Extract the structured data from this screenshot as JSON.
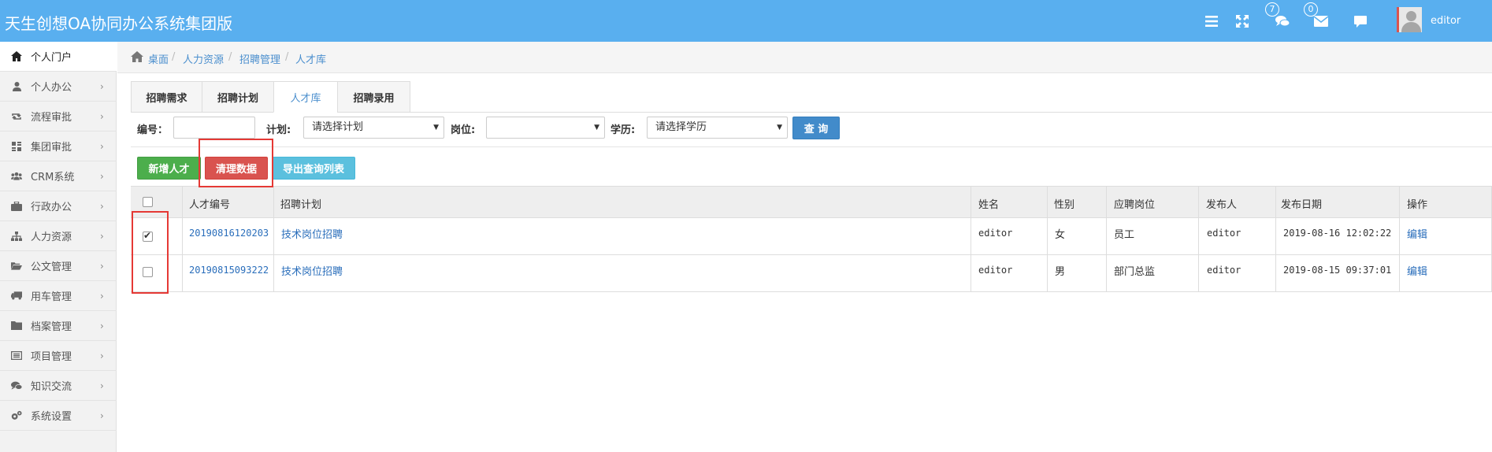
{
  "app": {
    "title": "天生创想OA协同办公系统集团版",
    "user": "editor",
    "badges": {
      "messages": "7",
      "mail": "0"
    }
  },
  "sidebar": {
    "items": [
      {
        "label": "个人门户",
        "icon": "home-icon"
      },
      {
        "label": "个人办公",
        "icon": "user-icon"
      },
      {
        "label": "流程审批",
        "icon": "retweet-icon"
      },
      {
        "label": "集团审批",
        "icon": "grid-icon"
      },
      {
        "label": "CRM系统",
        "icon": "users-icon"
      },
      {
        "label": "行政办公",
        "icon": "briefcase-icon"
      },
      {
        "label": "人力资源",
        "icon": "sitemap-icon"
      },
      {
        "label": "公文管理",
        "icon": "folder-open-icon"
      },
      {
        "label": "用车管理",
        "icon": "truck-icon"
      },
      {
        "label": "档案管理",
        "icon": "folder-icon"
      },
      {
        "label": "项目管理",
        "icon": "list-icon"
      },
      {
        "label": "知识交流",
        "icon": "comments-icon"
      },
      {
        "label": "系统设置",
        "icon": "cogs-icon"
      }
    ]
  },
  "breadcrumb": {
    "items": [
      "桌面",
      "人力资源",
      "招聘管理",
      "人才库"
    ]
  },
  "tabs": {
    "items": [
      "招聘需求",
      "招聘计划",
      "人才库",
      "招聘录用"
    ]
  },
  "filters": {
    "number_label": "编号：",
    "number_value": "",
    "plan_label": "计划:",
    "plan_value": "请选择计划",
    "position_label": "岗位:",
    "position_value": "",
    "education_label": "学历:",
    "education_value": "请选择学历",
    "query_label": "查 询"
  },
  "actions": {
    "add_label": "新增人才",
    "clear_label": "清理数据",
    "export_label": "导出查询列表"
  },
  "table": {
    "columns": [
      "人才编号",
      "招聘计划",
      "姓名",
      "性别",
      "应聘岗位",
      "发布人",
      "发布日期",
      "操作"
    ],
    "rows": [
      {
        "checked": true,
        "id": "20190816120203",
        "plan": "技术岗位招聘",
        "name": "editor",
        "gender": "女",
        "position": "员工",
        "publisher": "editor",
        "date": "2019-08-16 12:02:22",
        "action": "编辑"
      },
      {
        "checked": false,
        "id": "20190815093222",
        "plan": "技术岗位招聘",
        "name": "editor",
        "gender": "男",
        "position": "部门总监",
        "publisher": "editor",
        "date": "2019-08-15 09:37:01",
        "action": "编辑"
      }
    ]
  },
  "colors": {
    "topbar": "#59afef",
    "link": "#2a6ebb",
    "annotation": "#e53935"
  }
}
